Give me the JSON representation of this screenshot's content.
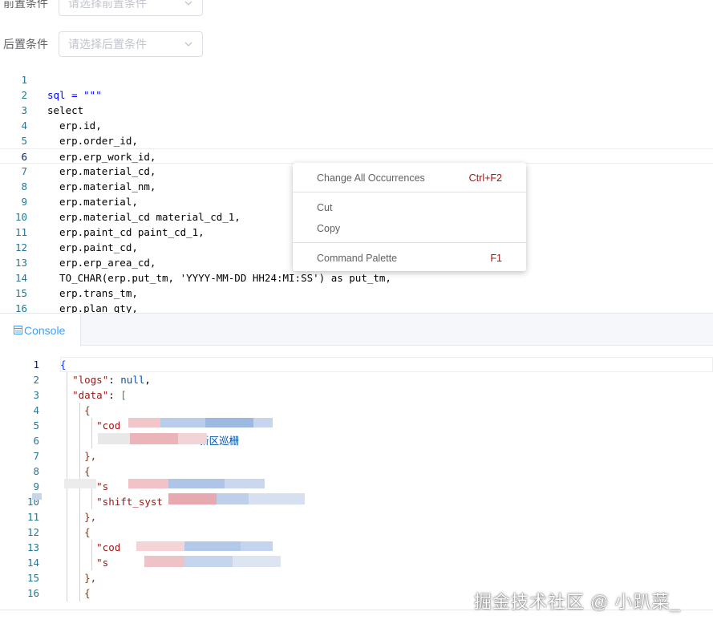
{
  "form": {
    "pre_label": "前置条件",
    "pre_placeholder": "请选择前置条件",
    "post_label": "后置条件",
    "post_placeholder": "请选择后置条件"
  },
  "editor": {
    "lines": [
      {
        "n": "1",
        "text": ""
      },
      {
        "n": "2",
        "text": "sql = \"\"\""
      },
      {
        "n": "3",
        "text": "select"
      },
      {
        "n": "4",
        "text": "  erp.id,"
      },
      {
        "n": "5",
        "text": "  erp.order_id,"
      },
      {
        "n": "6",
        "text": "  erp.erp_work_id,"
      },
      {
        "n": "7",
        "text": "  erp.material_cd,"
      },
      {
        "n": "8",
        "text": "  erp.material_nm,"
      },
      {
        "n": "9",
        "text": "  erp.material,"
      },
      {
        "n": "10",
        "text": "  erp.material_cd material_cd_1,"
      },
      {
        "n": "11",
        "text": "  erp.paint_cd paint_cd_1,"
      },
      {
        "n": "12",
        "text": "  erp.paint_cd,"
      },
      {
        "n": "13",
        "text": "  erp.erp_area_cd,"
      },
      {
        "n": "14",
        "text": "  TO_CHAR(erp.put_tm, 'YYYY-MM-DD HH24:MI:SS') as put_tm,"
      },
      {
        "n": "15",
        "text": "  erp.trans_tm,"
      },
      {
        "n": "16",
        "text": "  erp.plan_qty,"
      }
    ]
  },
  "context_menu": {
    "items": [
      {
        "label": "Change All Occurrences",
        "shortcut": "Ctrl+F2"
      },
      {
        "label": "Cut",
        "shortcut": ""
      },
      {
        "label": "Copy",
        "shortcut": ""
      },
      {
        "label": "Command Palette",
        "shortcut": "F1"
      }
    ]
  },
  "console": {
    "tab_label": "Console",
    "tab_icon": "console-icon",
    "lines": [
      {
        "n": "1",
        "text": "{"
      },
      {
        "n": "2",
        "text": "  \"logs\": null,"
      },
      {
        "n": "3",
        "text": "  \"data\": ["
      },
      {
        "n": "4",
        "text": "    {"
      },
      {
        "n": "5",
        "text": "      \"cod"
      },
      {
        "n": "6",
        "text": "                       新区巡栅"
      },
      {
        "n": "7",
        "text": "    },"
      },
      {
        "n": "8",
        "text": "    {"
      },
      {
        "n": "9",
        "text": "      \"s"
      },
      {
        "n": "10",
        "text": "      \"shift_syst"
      },
      {
        "n": "11",
        "text": "    },"
      },
      {
        "n": "12",
        "text": "    {"
      },
      {
        "n": "13",
        "text": "      \"cod"
      },
      {
        "n": "14",
        "text": "      \"s"
      },
      {
        "n": "15",
        "text": "    },"
      },
      {
        "n": "16",
        "text": "    {"
      }
    ]
  },
  "watermark": "掘金技术社区 @ 小趴菜_",
  "colors": {
    "accent": "#409eff",
    "line_number": "#237893",
    "keyword": "#0000ff",
    "string": "#a31515"
  }
}
